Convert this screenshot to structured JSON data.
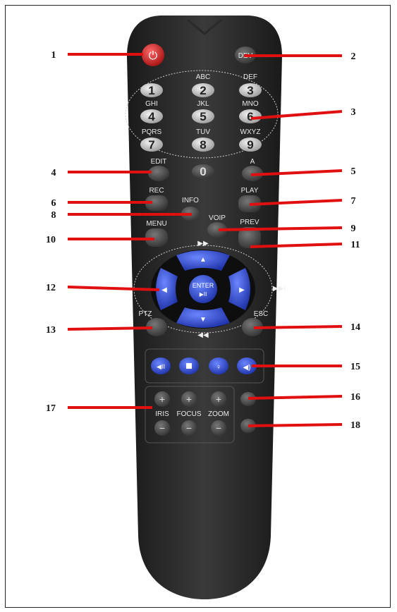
{
  "callouts": [
    "1",
    "2",
    "3",
    "4",
    "5",
    "6",
    "7",
    "8",
    "9",
    "10",
    "11",
    "12",
    "13",
    "14",
    "15",
    "16",
    "17",
    "18"
  ],
  "remote": {
    "dev_label": "DEV",
    "keypad": [
      {
        "num": "1",
        "letters": ""
      },
      {
        "num": "2",
        "letters": "ABC"
      },
      {
        "num": "3",
        "letters": "DEF"
      },
      {
        "num": "4",
        "letters": "GHI"
      },
      {
        "num": "5",
        "letters": "JKL"
      },
      {
        "num": "6",
        "letters": "MNO"
      },
      {
        "num": "7",
        "letters": "PQRS"
      },
      {
        "num": "8",
        "letters": "TUV"
      },
      {
        "num": "9",
        "letters": "WXYZ"
      },
      {
        "num": "0",
        "letters": ""
      }
    ],
    "edit": "EDIT",
    "a": "A",
    "rec": "REC",
    "info": "INFO",
    "play": "PLAY",
    "menu": "MENU",
    "voip": "VOIP",
    "prev": "PREV",
    "enter": "ENTER",
    "enter_sub": "▶II",
    "ptz": "PTZ",
    "esc": "ESC",
    "iris": "IRIS",
    "focus": "FOCUS",
    "zoom": "ZOOM",
    "ff_symbol": "▶▶",
    "rew_symbol": "◀◀",
    "next_symbol": "▶▶I"
  }
}
